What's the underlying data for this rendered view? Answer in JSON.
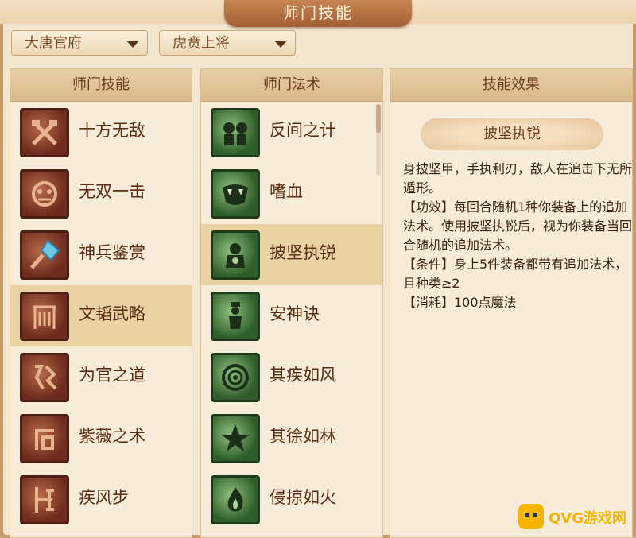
{
  "window": {
    "title": "师门技能"
  },
  "dropdowns": [
    {
      "value": "大唐官府"
    },
    {
      "value": "虎贲上将"
    }
  ],
  "panels": {
    "skills": {
      "header": "师门技能",
      "items": [
        {
          "label": "十方无敌",
          "icon": "crossed-axes-icon"
        },
        {
          "label": "无双一击",
          "icon": "beast-face-icon"
        },
        {
          "label": "神兵鉴赏",
          "icon": "gem-weapon-icon"
        },
        {
          "label": "文韬武略",
          "icon": "gate-icon",
          "selected": true
        },
        {
          "label": "为官之道",
          "icon": "seal-icon"
        },
        {
          "label": "紫薇之术",
          "icon": "rune-icon"
        },
        {
          "label": "疾风步",
          "icon": "footstep-icon"
        }
      ]
    },
    "spells": {
      "header": "师门法术",
      "items": [
        {
          "label": "反间之计",
          "icon": "two-heads-icon"
        },
        {
          "label": "嗜血",
          "icon": "fangs-icon"
        },
        {
          "label": "披坚执锐",
          "icon": "armored-figure-icon",
          "selected": true
        },
        {
          "label": "安神诀",
          "icon": "meditating-figure-icon"
        },
        {
          "label": "其疾如风",
          "icon": "wind-swirl-icon"
        },
        {
          "label": "其徐如林",
          "icon": "forest-star-icon"
        },
        {
          "label": "侵掠如火",
          "icon": "fire-glyph-icon"
        }
      ]
    },
    "effect": {
      "header": "技能效果",
      "skill_name": "披坚执锐",
      "lines": [
        "身披坚甲，手执利刃，敌人在追击下无所遁形。",
        "【功效】每回合随机1种你装备上的追加法术。使用披坚执锐后，视为你装备当回合随机的追加法术。",
        "【条件】身上5件装备都带有追加法术，且种类≥2",
        "【消耗】100点魔法"
      ]
    }
  },
  "watermark": {
    "text": "QVG游戏网",
    "icon": "gamepad-icon"
  },
  "colors": {
    "accent": "#a35e33",
    "selected_row": "#ead2a3",
    "text": "#5a2e12"
  }
}
